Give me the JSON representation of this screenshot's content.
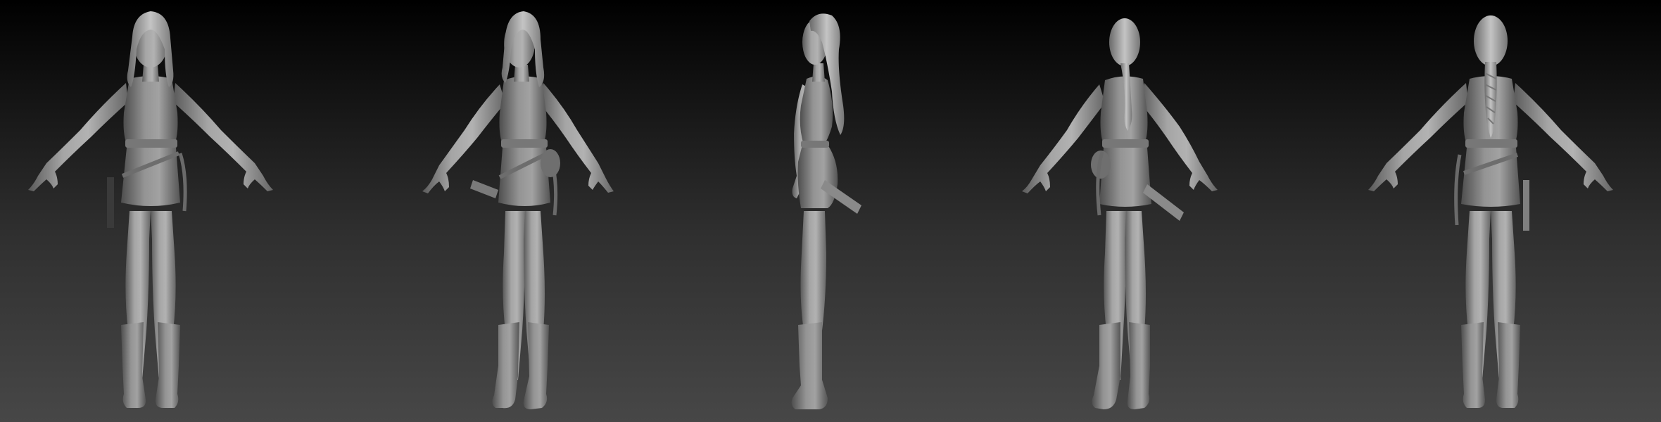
{
  "viewport": {
    "background_top": "#000000",
    "background_bottom": "#474747",
    "material_color": "#8f8f8f",
    "material_highlight": "#b4b4b4",
    "material_shadow": "#555555"
  },
  "model_views": [
    {
      "view": "front"
    },
    {
      "view": "front-three-quarter"
    },
    {
      "view": "side"
    },
    {
      "view": "back-three-quarter"
    },
    {
      "view": "back"
    }
  ]
}
